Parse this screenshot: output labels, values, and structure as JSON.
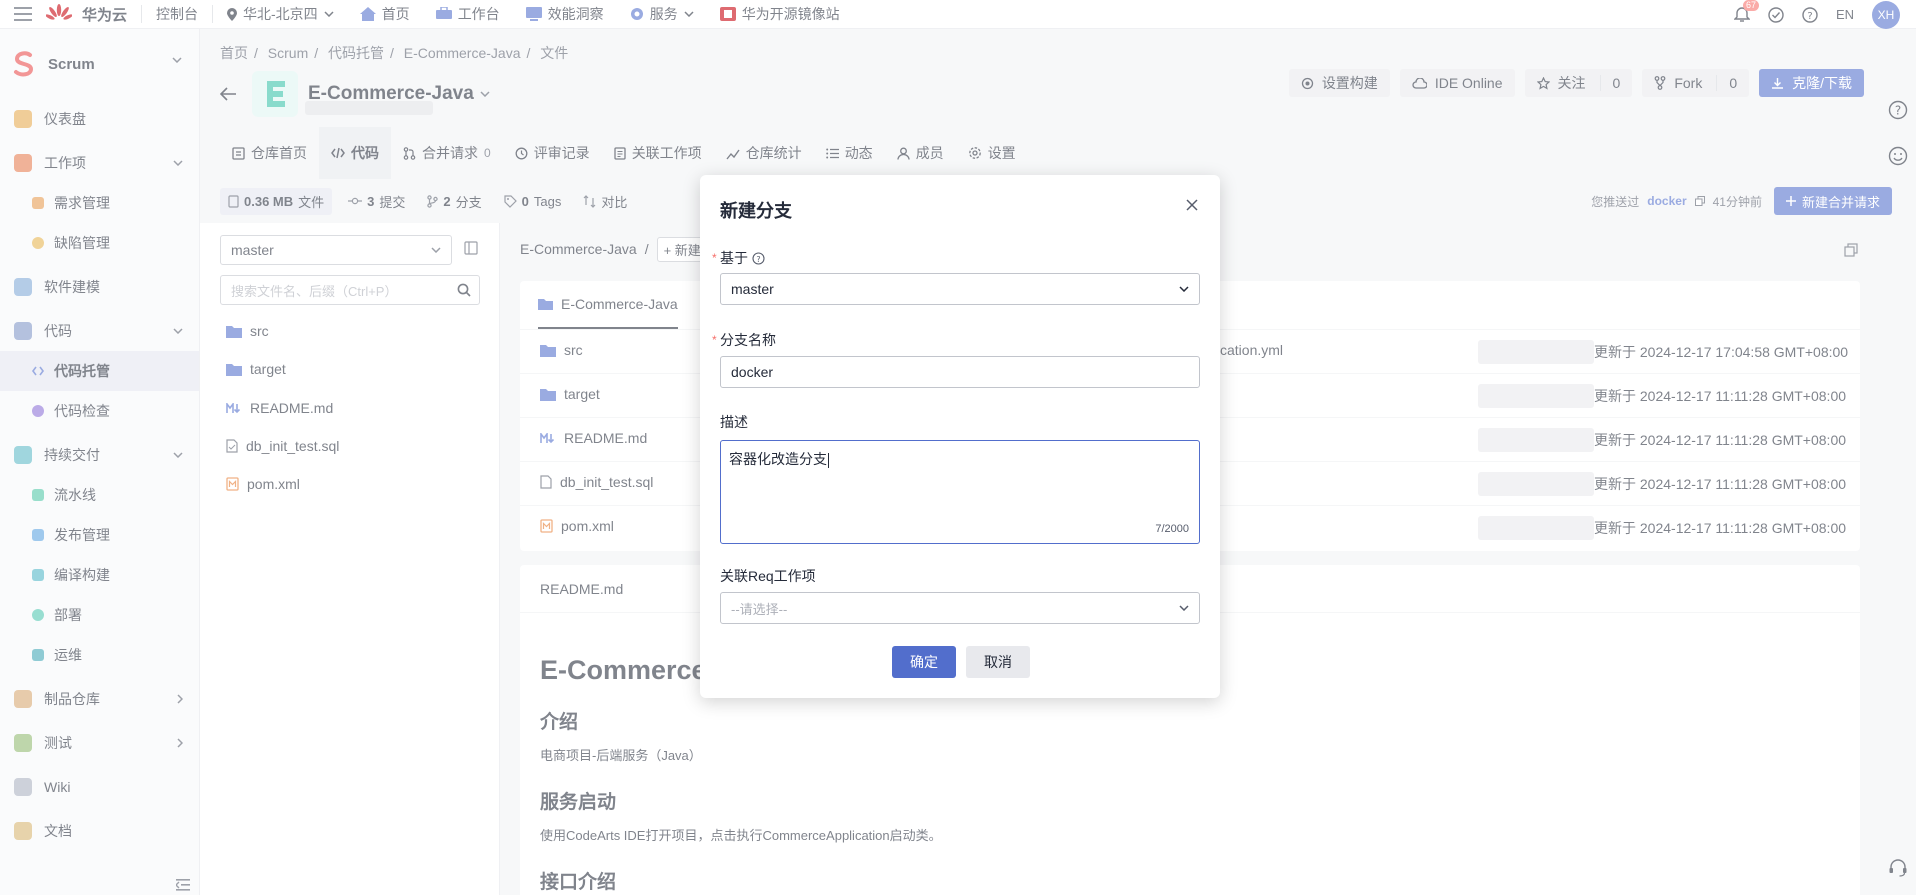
{
  "topbar": {
    "brand": "华为云",
    "console": "控制台",
    "region": "华北-北京四",
    "nav": [
      "首页",
      "工作台",
      "效能洞察",
      "服务",
      "华为开源镜像站"
    ],
    "notif_count": "67",
    "lang": "EN",
    "avatar": "XH"
  },
  "sidebar": {
    "project": "Scrum",
    "items": {
      "dashboard": "仪表盘",
      "workitems": "工作项",
      "req": "需求管理",
      "bug": "缺陷管理",
      "modeling": "软件建模",
      "code": "代码",
      "repo": "代码托管",
      "codecheck": "代码检查",
      "cd": "持续交付",
      "pipeline": "流水线",
      "release": "发布管理",
      "build": "编译构建",
      "deploy": "部署",
      "ops": "运维",
      "artifact": "制品仓库",
      "test": "测试",
      "wiki": "Wiki",
      "docs": "文档"
    }
  },
  "breadcrumb": [
    "首页",
    "Scrum",
    "代码托管",
    "E-Commerce-Java",
    "文件"
  ],
  "repo": {
    "name": "E-Commerce-Java",
    "btn_build": "设置构建",
    "btn_ide": "IDE Online",
    "btn_follow": "关注",
    "follow_count": "0",
    "btn_fork": "Fork",
    "fork_count": "0",
    "btn_clone": "克隆/下载"
  },
  "tabs": {
    "home": "仓库首页",
    "code": "代码",
    "mr": "合并请求",
    "mr_count": "0",
    "review": "评审记录",
    "link": "关联工作项",
    "stats": "仓库统计",
    "activity": "动态",
    "members": "成员",
    "settings": "设置"
  },
  "stats": {
    "size": "0.36 MB",
    "size_unit": "文件",
    "commits": "3",
    "commits_unit": "提交",
    "branches": "2",
    "branches_unit": "分支",
    "tags": "0",
    "tags_unit": "Tags",
    "compare": "对比",
    "pushed_prefix": "您推送过",
    "pushed_branch": "docker",
    "pushed_time": "41分钟前",
    "new_mr": "新建合并请求"
  },
  "tree": {
    "branch": "master",
    "search_placeholder": "搜索文件名、后缀（Ctrl+P）",
    "nodes": [
      "src",
      "target",
      "README.md",
      "db_init_test.sql",
      "pom.xml"
    ]
  },
  "content": {
    "path_root": "E-Commerce-Java",
    "path_sep": "/",
    "new_btn": "+ 新建",
    "tab": "E-Commerce-Java",
    "files": [
      {
        "name": "src",
        "msg": "cation.yml",
        "time": "更新于 2024-12-17 17:04:58 GMT+08:00"
      },
      {
        "name": "target",
        "msg": "",
        "time": "更新于 2024-12-17 11:11:28 GMT+08:00"
      },
      {
        "name": "README.md",
        "msg": "",
        "time": "更新于 2024-12-17 11:11:28 GMT+08:00"
      },
      {
        "name": "db_init_test.sql",
        "msg": "",
        "time": "更新于 2024-12-17 11:11:28 GMT+08:00"
      },
      {
        "name": "pom.xml",
        "msg": "",
        "time": "更新于 2024-12-17 11:11:28 GMT+08:00"
      }
    ],
    "readme_title": "README.md",
    "md_h1": "E-Commerce-Java",
    "md_intro_h": "介绍",
    "md_intro_p": "电商项目-后端服务（Java）",
    "md_start_h": "服务启动",
    "md_start_p": "使用CodeArts IDE打开项目，点击执行CommerceApplication启动类。",
    "md_api_h": "接口介绍"
  },
  "modal": {
    "title": "新建分支",
    "based_on_label": "基于",
    "based_on_value": "master",
    "name_label": "分支名称",
    "name_value": "docker",
    "desc_label": "描述",
    "desc_value": "容器化改造分支",
    "desc_count": "7/2000",
    "link_label": "关联Req工作项",
    "link_placeholder": "--请选择--",
    "ok": "确定",
    "cancel": "取消"
  }
}
